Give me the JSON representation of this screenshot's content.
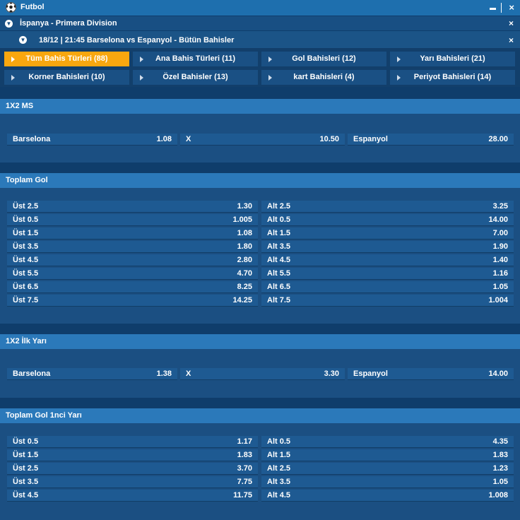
{
  "header": {
    "title": "Futbol",
    "league": "İspanya - Primera Division",
    "match": "18/12 | 21:45 Barselona vs Espanyol - Bütün Bahisler",
    "minimize_icon": "minimize-icon",
    "close_icon": "×"
  },
  "filters": [
    {
      "label": "Tüm Bahis Türleri (88)",
      "active": true
    },
    {
      "label": "Ana Bahis Türleri (11)",
      "active": false
    },
    {
      "label": "Gol Bahisleri (12)",
      "active": false
    },
    {
      "label": "Yarı Bahisleri (21)",
      "active": false
    },
    {
      "label": "Korner Bahisleri (10)",
      "active": false
    },
    {
      "label": "Özel Bahisler (13)",
      "active": false
    },
    {
      "label": "kart Bahisleri (4)",
      "active": false
    },
    {
      "label": "Periyot Bahisleri (14)",
      "active": false
    }
  ],
  "markets": {
    "ms": {
      "title": "1X2 MS",
      "home": {
        "label": "Barselona",
        "odd": "1.08"
      },
      "draw": {
        "label": "X",
        "odd": "10.50"
      },
      "away": {
        "label": "Espanyol",
        "odd": "28.00"
      }
    },
    "total_goals": {
      "title": "Toplam Gol",
      "rows": [
        {
          "over": "Üst 2.5",
          "over_odd": "1.30",
          "under": "Alt 2.5",
          "under_odd": "3.25"
        },
        {
          "over": "Üst 0.5",
          "over_odd": "1.005",
          "under": "Alt 0.5",
          "under_odd": "14.00"
        },
        {
          "over": "Üst 1.5",
          "over_odd": "1.08",
          "under": "Alt 1.5",
          "under_odd": "7.00"
        },
        {
          "over": "Üst 3.5",
          "over_odd": "1.80",
          "under": "Alt 3.5",
          "under_odd": "1.90"
        },
        {
          "over": "Üst 4.5",
          "over_odd": "2.80",
          "under": "Alt 4.5",
          "under_odd": "1.40"
        },
        {
          "over": "Üst 5.5",
          "over_odd": "4.70",
          "under": "Alt 5.5",
          "under_odd": "1.16"
        },
        {
          "over": "Üst 6.5",
          "over_odd": "8.25",
          "under": "Alt 6.5",
          "under_odd": "1.05"
        },
        {
          "over": "Üst 7.5",
          "over_odd": "14.25",
          "under": "Alt 7.5",
          "under_odd": "1.004"
        }
      ]
    },
    "ht": {
      "title": "1X2 İlk Yarı",
      "home": {
        "label": "Barselona",
        "odd": "1.38"
      },
      "draw": {
        "label": "X",
        "odd": "3.30"
      },
      "away": {
        "label": "Espanyol",
        "odd": "14.00"
      }
    },
    "total_goals_ht": {
      "title": "Toplam Gol 1nci Yarı",
      "rows": [
        {
          "over": "Üst 0.5",
          "over_odd": "1.17",
          "under": "Alt 0.5",
          "under_odd": "4.35"
        },
        {
          "over": "Üst 1.5",
          "over_odd": "1.83",
          "under": "Alt 1.5",
          "under_odd": "1.83"
        },
        {
          "over": "Üst 2.5",
          "over_odd": "3.70",
          "under": "Alt 2.5",
          "under_odd": "1.23"
        },
        {
          "over": "Üst 3.5",
          "over_odd": "7.75",
          "under": "Alt 3.5",
          "under_odd": "1.05"
        },
        {
          "over": "Üst 4.5",
          "over_odd": "11.75",
          "under": "Alt 4.5",
          "under_odd": "1.008"
        }
      ]
    }
  }
}
